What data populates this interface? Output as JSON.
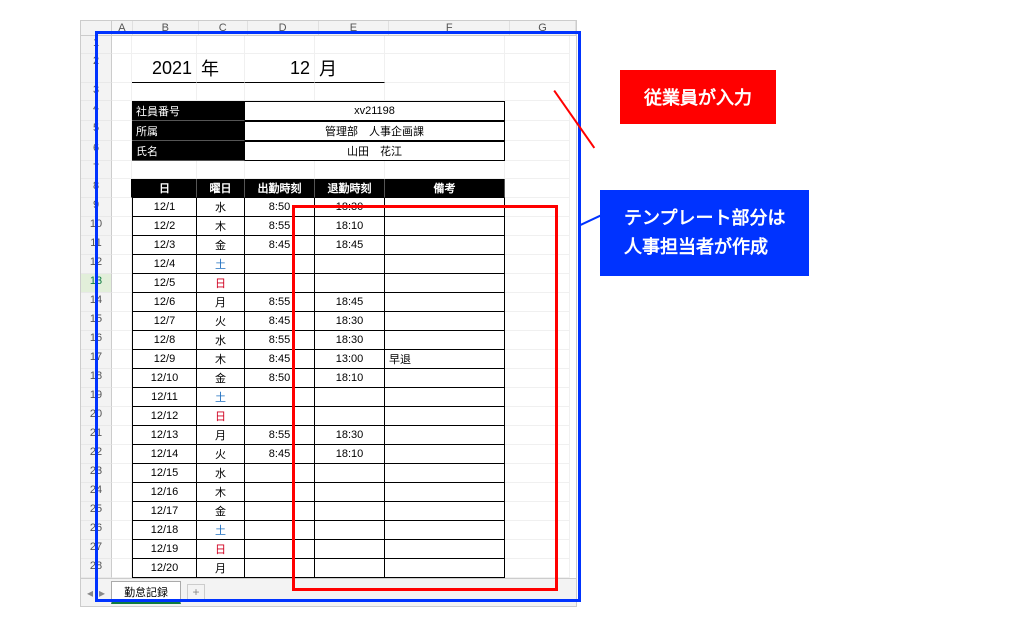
{
  "columns": [
    "A",
    "B",
    "C",
    "D",
    "E",
    "F",
    "G"
  ],
  "year_value": "2021",
  "year_label": "年",
  "month_value": "12",
  "month_label": "月",
  "info": {
    "emp_id_label": "社員番号",
    "emp_id_value": "xv21198",
    "dept_label": "所属",
    "dept_value": "管理部　人事企画課",
    "name_label": "氏名",
    "name_value": "山田　花江"
  },
  "table_headers": {
    "date": "日",
    "dow": "曜日",
    "in": "出勤時刻",
    "out": "退勤時刻",
    "note": "備考"
  },
  "rows": [
    {
      "rownum": 9,
      "date": "12/1",
      "dow": "水",
      "dow_cls": "",
      "in": "8:50",
      "out": "18:30",
      "note": ""
    },
    {
      "rownum": 10,
      "date": "12/2",
      "dow": "木",
      "dow_cls": "",
      "in": "8:55",
      "out": "18:10",
      "note": ""
    },
    {
      "rownum": 11,
      "date": "12/3",
      "dow": "金",
      "dow_cls": "",
      "in": "8:45",
      "out": "18:45",
      "note": ""
    },
    {
      "rownum": 12,
      "date": "12/4",
      "dow": "土",
      "dow_cls": "sat",
      "in": "",
      "out": "",
      "note": ""
    },
    {
      "rownum": 13,
      "date": "12/5",
      "dow": "日",
      "dow_cls": "sun",
      "in": "",
      "out": "",
      "note": "",
      "sel": true
    },
    {
      "rownum": 14,
      "date": "12/6",
      "dow": "月",
      "dow_cls": "",
      "in": "8:55",
      "out": "18:45",
      "note": ""
    },
    {
      "rownum": 15,
      "date": "12/7",
      "dow": "火",
      "dow_cls": "",
      "in": "8:45",
      "out": "18:30",
      "note": ""
    },
    {
      "rownum": 16,
      "date": "12/8",
      "dow": "水",
      "dow_cls": "",
      "in": "8:55",
      "out": "18:30",
      "note": ""
    },
    {
      "rownum": 17,
      "date": "12/9",
      "dow": "木",
      "dow_cls": "",
      "in": "8:45",
      "out": "13:00",
      "note": "早退"
    },
    {
      "rownum": 18,
      "date": "12/10",
      "dow": "金",
      "dow_cls": "",
      "in": "8:50",
      "out": "18:10",
      "note": ""
    },
    {
      "rownum": 19,
      "date": "12/11",
      "dow": "土",
      "dow_cls": "sat",
      "in": "",
      "out": "",
      "note": ""
    },
    {
      "rownum": 20,
      "date": "12/12",
      "dow": "日",
      "dow_cls": "sun",
      "in": "",
      "out": "",
      "note": ""
    },
    {
      "rownum": 21,
      "date": "12/13",
      "dow": "月",
      "dow_cls": "",
      "in": "8:55",
      "out": "18:30",
      "note": ""
    },
    {
      "rownum": 22,
      "date": "12/14",
      "dow": "火",
      "dow_cls": "",
      "in": "8:45",
      "out": "18:10",
      "note": ""
    },
    {
      "rownum": 23,
      "date": "12/15",
      "dow": "水",
      "dow_cls": "",
      "in": "",
      "out": "",
      "note": ""
    },
    {
      "rownum": 24,
      "date": "12/16",
      "dow": "木",
      "dow_cls": "",
      "in": "",
      "out": "",
      "note": ""
    },
    {
      "rownum": 25,
      "date": "12/17",
      "dow": "金",
      "dow_cls": "",
      "in": "",
      "out": "",
      "note": ""
    },
    {
      "rownum": 26,
      "date": "12/18",
      "dow": "土",
      "dow_cls": "sat",
      "in": "",
      "out": "",
      "note": ""
    },
    {
      "rownum": 27,
      "date": "12/19",
      "dow": "日",
      "dow_cls": "sun",
      "in": "",
      "out": "",
      "note": ""
    },
    {
      "rownum": 28,
      "date": "12/20",
      "dow": "月",
      "dow_cls": "",
      "in": "",
      "out": "",
      "note": ""
    }
  ],
  "sheet_tab": "勤怠記録",
  "callout_red": "従業員が入力",
  "callout_blue_line1": "テンプレート部分は",
  "callout_blue_line2": "人事担当者が作成"
}
